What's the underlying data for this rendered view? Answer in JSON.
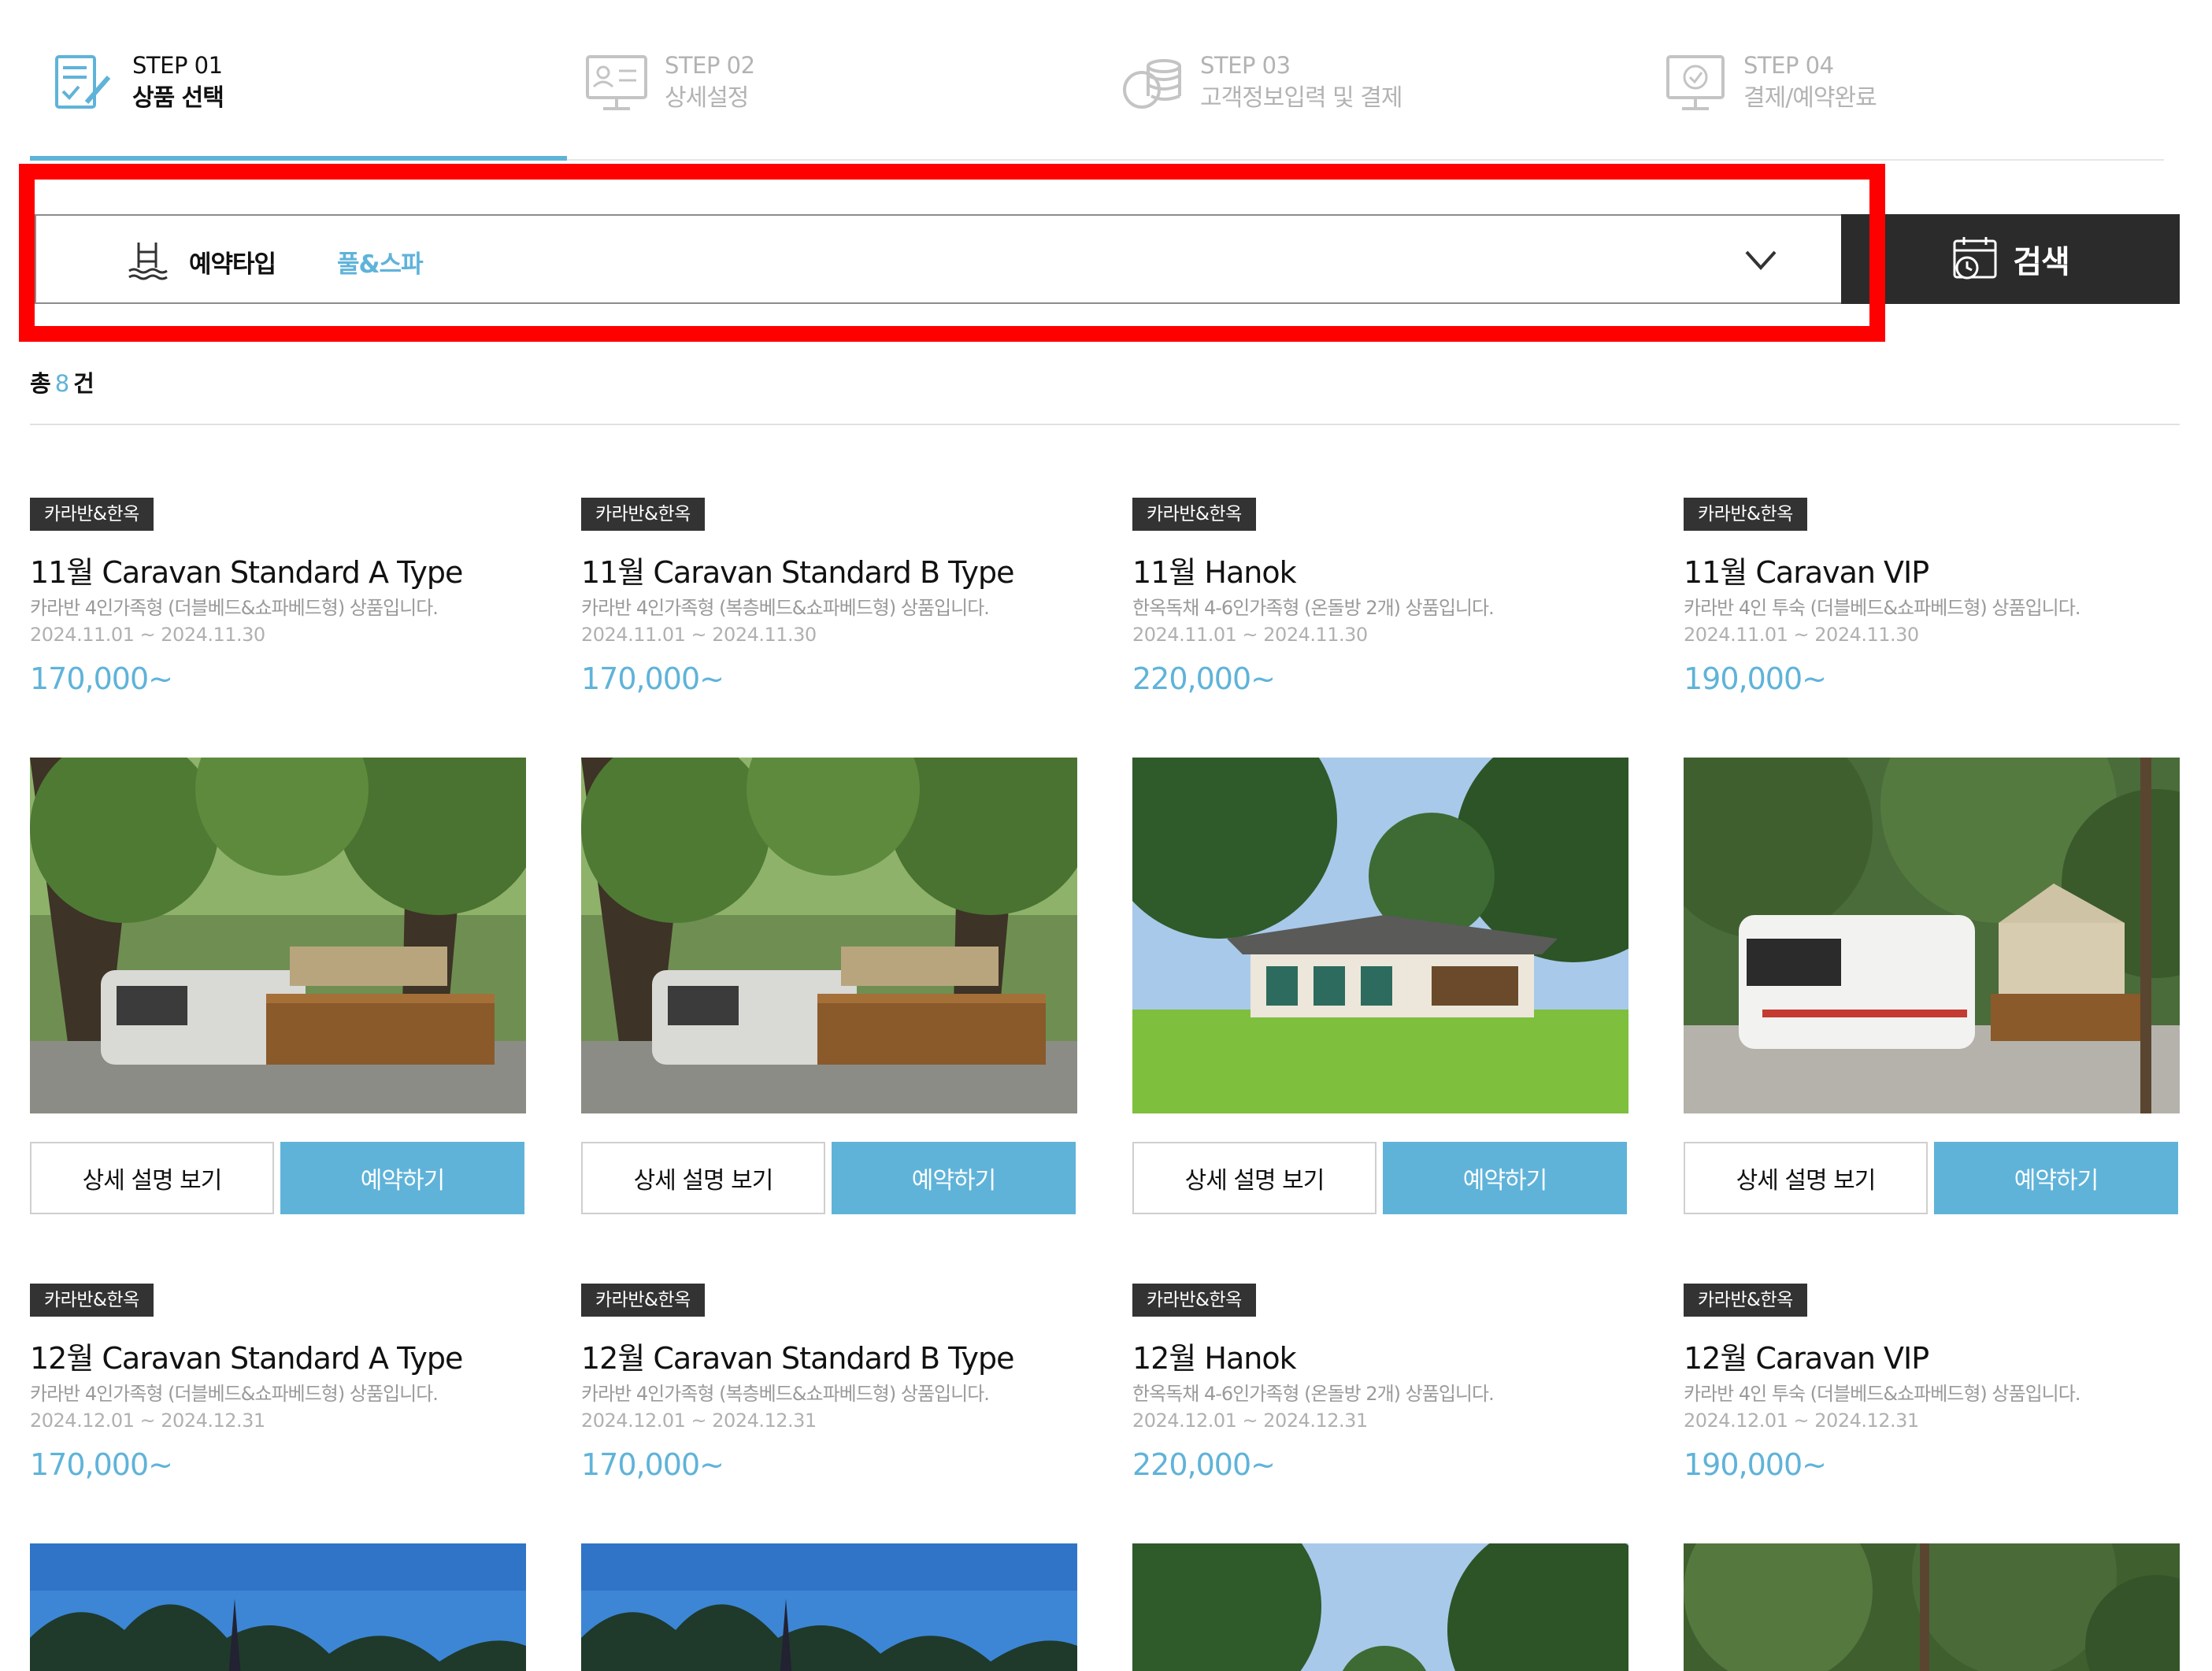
{
  "steps": [
    {
      "num": "STEP 01",
      "name": "상품 선택",
      "icon": "checklist-pen-icon",
      "active": true
    },
    {
      "num": "STEP 02",
      "name": "상세설정",
      "icon": "monitor-profile-icon",
      "active": false
    },
    {
      "num": "STEP 03",
      "name": "고객정보입력 및 결제",
      "icon": "coins-icon",
      "active": false
    },
    {
      "num": "STEP 04",
      "name": "결제/예약완료",
      "icon": "monitor-check-icon",
      "active": false
    }
  ],
  "filter": {
    "label": "예약타입",
    "value": "풀&스파",
    "icon": "pool-ladder-icon",
    "chevron": "chevron-down-icon"
  },
  "search": {
    "label": "검색",
    "icon": "calendar-clock-icon"
  },
  "total": {
    "prefix": "총",
    "count": "8",
    "suffix": "건"
  },
  "products": [
    {
      "badge": "카라반&한옥",
      "title": "11월 Caravan Standard A Type",
      "desc": "카라반 4인가족형 (더블베드&쇼파베드형) 상품입니다.",
      "date": "2024.11.01 ~ 2024.11.30",
      "price": "170,000~",
      "photo": "caravan-standard",
      "detail_label": "상세 설명 보기",
      "reserve_label": "예약하기"
    },
    {
      "badge": "카라반&한옥",
      "title": "11월 Caravan Standard B Type",
      "desc": "카라반 4인가족형 (복층베드&쇼파베드형) 상품입니다.",
      "date": "2024.11.01 ~ 2024.11.30",
      "price": "170,000~",
      "photo": "caravan-standard",
      "detail_label": "상세 설명 보기",
      "reserve_label": "예약하기"
    },
    {
      "badge": "카라반&한옥",
      "title": "11월 Hanok",
      "desc": "한옥독채 4-6인가족형 (온돌방 2개) 상품입니다.",
      "date": "2024.11.01 ~ 2024.11.30",
      "price": "220,000~",
      "photo": "hanok",
      "detail_label": "상세 설명 보기",
      "reserve_label": "예약하기"
    },
    {
      "badge": "카라반&한옥",
      "title": "11월 Caravan VIP",
      "desc": "카라반 4인 투숙 (더블베드&쇼파베드형) 상품입니다.",
      "date": "2024.11.01 ~ 2024.11.30",
      "price": "190,000~",
      "photo": "caravan-vip",
      "detail_label": "상세 설명 보기",
      "reserve_label": "예약하기"
    },
    {
      "badge": "카라반&한옥",
      "title": "12월 Caravan Standard A Type",
      "desc": "카라반 4인가족형 (더블베드&쇼파베드형) 상품입니다.",
      "date": "2024.12.01 ~ 2024.12.31",
      "price": "170,000~",
      "photo": "sky-pines"
    },
    {
      "badge": "카라반&한옥",
      "title": "12월 Caravan Standard B Type",
      "desc": "카라반 4인가족형 (복층베드&쇼파베드형) 상품입니다.",
      "date": "2024.12.01 ~ 2024.12.31",
      "price": "170,000~",
      "photo": "sky-pines"
    },
    {
      "badge": "카라반&한옥",
      "title": "12월 Hanok",
      "desc": "한옥독채 4-6인가족형 (온돌방 2개) 상품입니다.",
      "date": "2024.12.01 ~ 2024.12.31",
      "price": "220,000~",
      "photo": "hanok-top"
    },
    {
      "badge": "카라반&한옥",
      "title": "12월 Caravan VIP",
      "desc": "카라반 4인 투숙 (더블베드&쇼파베드형) 상품입니다.",
      "date": "2024.12.01 ~ 2024.12.31",
      "price": "190,000~",
      "photo": "forest-top"
    }
  ],
  "colors": {
    "accent": "#5fb3d9",
    "dark": "#2b2b2b",
    "highlight": "#ff0000"
  }
}
